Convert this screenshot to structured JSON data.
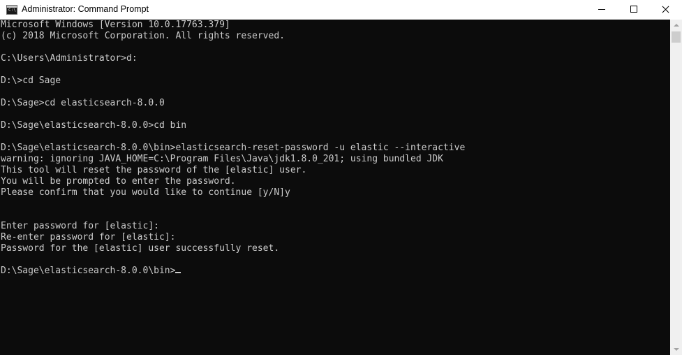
{
  "window": {
    "title": "Administrator: Command Prompt",
    "icon": "cmd-icon",
    "icon_glyph": "C:\\",
    "buttons": {
      "minimize": "minimize-icon",
      "maximize": "maximize-icon",
      "close": "close-icon"
    }
  },
  "console": {
    "lines": [
      "Microsoft Windows [Version 10.0.17763.379]",
      "(c) 2018 Microsoft Corporation. All rights reserved.",
      "",
      "C:\\Users\\Administrator>d:",
      "",
      "D:\\>cd Sage",
      "",
      "D:\\Sage>cd elasticsearch-8.0.0",
      "",
      "D:\\Sage\\elasticsearch-8.0.0>cd bin",
      "",
      "D:\\Sage\\elasticsearch-8.0.0\\bin>elasticsearch-reset-password -u elastic --interactive",
      "warning: ignoring JAVA_HOME=C:\\Program Files\\Java\\jdk1.8.0_201; using bundled JDK",
      "This tool will reset the password of the [elastic] user.",
      "You will be prompted to enter the password.",
      "Please confirm that you would like to continue [y/N]y",
      "",
      "",
      "Enter password for [elastic]:",
      "Re-enter password for [elastic]:",
      "Password for the [elastic] user successfully reset.",
      ""
    ],
    "prompt": "D:\\Sage\\elasticsearch-8.0.0\\bin>"
  },
  "colors": {
    "console_background": "#0c0c0c",
    "console_text": "#cccccc",
    "titlebar_background": "#ffffff"
  }
}
